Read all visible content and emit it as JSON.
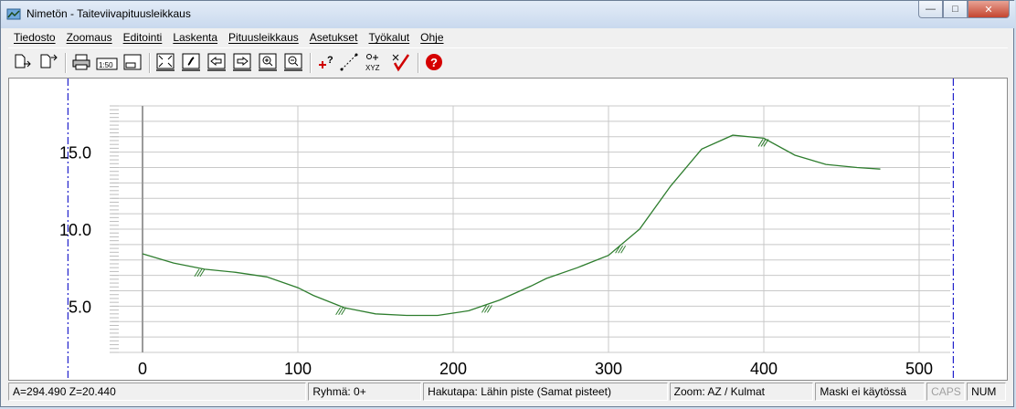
{
  "window": {
    "title": "Nimetön - Taiteviivapituusleikkaus",
    "controls": {
      "minimize": "—",
      "maximize": "□",
      "close": "✕"
    }
  },
  "menu": [
    "Tiedosto",
    "Zoomaus",
    "Editointi",
    "Laskenta",
    "Pituusleikkaus",
    "Asetukset",
    "Työkalut",
    "Ohje"
  ],
  "toolbar": {
    "scale_label": "1:50",
    "xyz_label": "XYZ"
  },
  "chart_data": {
    "type": "line",
    "x_ticks": [
      "0",
      "100",
      "200",
      "300",
      "400",
      "500"
    ],
    "y_ticks": [
      "5.0",
      "10.0",
      "15.0"
    ],
    "xlim": [
      -20,
      520
    ],
    "ylim": [
      2.0,
      18.0
    ],
    "grid": true,
    "line_color": "#2e7d2e",
    "series": [
      {
        "x": [
          0,
          20,
          40,
          60,
          80,
          100,
          110,
          130,
          150,
          170,
          190,
          210,
          230,
          250,
          260,
          280,
          300,
          320,
          340,
          360,
          380,
          400,
          420,
          440,
          460,
          475
        ],
        "y": [
          8.4,
          7.8,
          7.4,
          7.2,
          6.9,
          6.2,
          5.7,
          4.9,
          4.5,
          4.4,
          4.4,
          4.7,
          5.4,
          6.3,
          6.8,
          7.5,
          8.3,
          10.0,
          12.8,
          15.2,
          16.1,
          15.9,
          14.8,
          14.2,
          14.0,
          13.9
        ]
      }
    ],
    "break_marks_x": [
      37,
      128,
      222,
      308,
      400
    ],
    "boundary_lines_x": [
      -48,
      522
    ]
  },
  "status": {
    "coords": "A=294.490  Z=20.440",
    "group": "Ryhmä: 0+",
    "search": "Hakutapa: Lähin piste (Samat pisteet)",
    "zoom": "Zoom: AZ  /  Kulmat",
    "mask": "Maski ei käytössä",
    "caps": "CAPS",
    "num": "NUM"
  }
}
